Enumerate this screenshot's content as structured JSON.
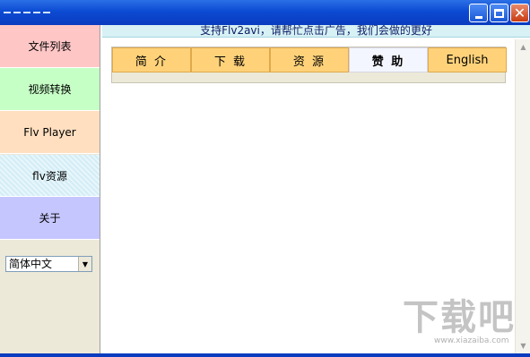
{
  "window": {
    "minimize_icon": "minimize-icon",
    "maximize_icon": "maximize-icon",
    "close_icon": "close-icon",
    "close_glyph": "✕"
  },
  "sidebar": {
    "items": [
      {
        "label": "文件列表",
        "color": "#ffc6c6"
      },
      {
        "label": "视频转换",
        "color": "#c6ffc6"
      },
      {
        "label": "Flv Player",
        "color": "#ffdfc0"
      },
      {
        "label": "flv资源",
        "color": "#e8f6fb"
      },
      {
        "label": "关于",
        "color": "#c6c6ff"
      }
    ],
    "language_select": {
      "value": "简体中文",
      "arrow": "▼"
    }
  },
  "main": {
    "banner": "支持Flv2avi，请帮忙点击广告，我们会做的更好",
    "tabs": [
      {
        "label": "简 介",
        "active": false
      },
      {
        "label": "下 载",
        "active": false
      },
      {
        "label": "资 源",
        "active": false
      },
      {
        "label": "赞 助",
        "active": true
      },
      {
        "label": "English",
        "active": false
      }
    ],
    "scroll_up": "▲",
    "scroll_down": "▼"
  },
  "watermark": {
    "logo": "下载吧",
    "url": "www.xiazaiba.com"
  },
  "colors": {
    "titlebar": "#0c4bd3",
    "tab": "#ffd27a",
    "active_tab": "#f4f6ff",
    "banner": "#d7f1f4"
  }
}
